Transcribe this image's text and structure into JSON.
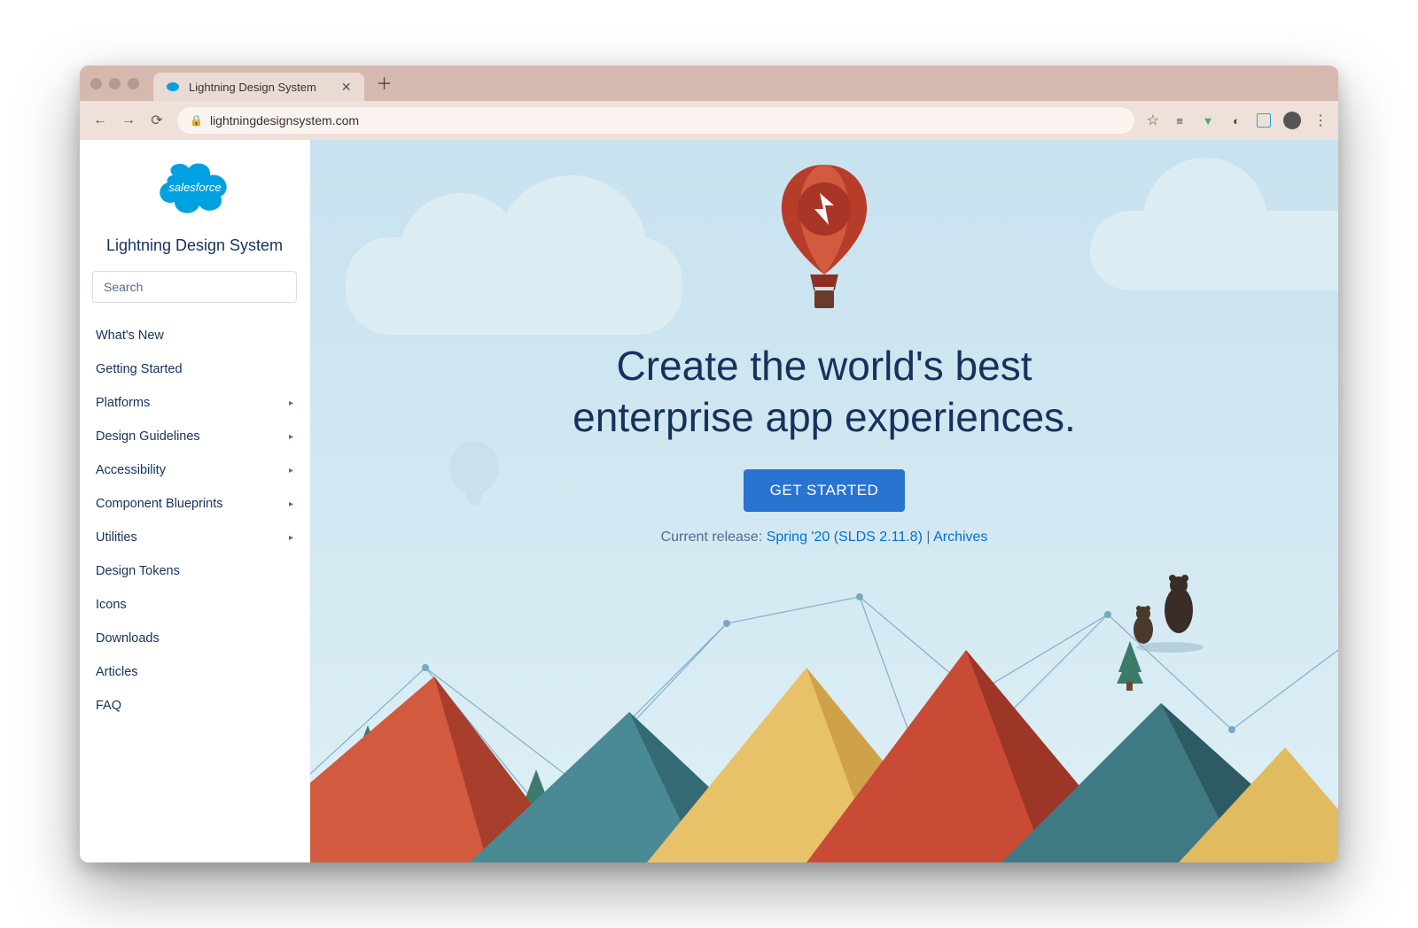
{
  "browser": {
    "tab_title": "Lightning Design System",
    "url": "lightningdesignsystem.com"
  },
  "sidebar": {
    "brand_title": "Lightning Design System",
    "search_placeholder": "Search",
    "items": [
      {
        "label": "What's New",
        "expandable": false
      },
      {
        "label": "Getting Started",
        "expandable": false
      },
      {
        "label": "Platforms",
        "expandable": true
      },
      {
        "label": "Design Guidelines",
        "expandable": true
      },
      {
        "label": "Accessibility",
        "expandable": true
      },
      {
        "label": "Component Blueprints",
        "expandable": true
      },
      {
        "label": "Utilities",
        "expandable": true
      },
      {
        "label": "Design Tokens",
        "expandable": false
      },
      {
        "label": "Icons",
        "expandable": false
      },
      {
        "label": "Downloads",
        "expandable": false
      },
      {
        "label": "Articles",
        "expandable": false
      },
      {
        "label": "FAQ",
        "expandable": false
      }
    ]
  },
  "hero": {
    "headline_line1": "Create the world's best",
    "headline_line2": "enterprise app experiences.",
    "cta_label": "GET STARTED",
    "release_prefix": "Current release: ",
    "release_link": "Spring '20 (SLDS 2.11.8)",
    "release_separator": " | ",
    "archives_link": "Archives"
  }
}
